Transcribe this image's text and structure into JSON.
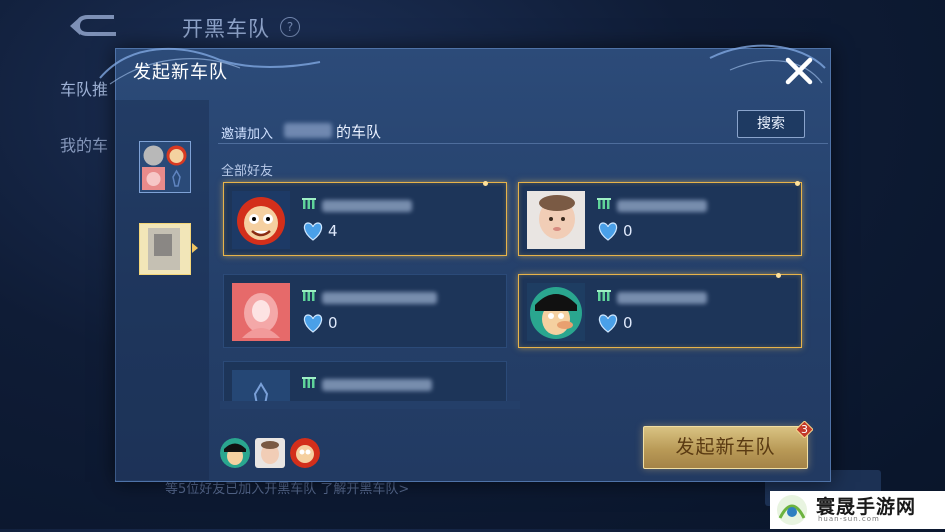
{
  "background": {
    "title": "开黑车队",
    "help": "?",
    "sidebar_item_1": "车队推",
    "sidebar_item_2": "我的车",
    "footer_hint": "等5位好友已加入开黑车队  了解开黑车队>"
  },
  "dialog": {
    "title": "发起新车队",
    "invite_prefix": "邀请加入",
    "invite_suffix": "的车队",
    "search_label": "搜索",
    "section_label": "全部好友",
    "start_button": "发起新车队",
    "start_badge": "3"
  },
  "friends": [
    {
      "hearts": "4",
      "selected": true,
      "avatar": "cartoon-red-face"
    },
    {
      "hearts": "0",
      "selected": true,
      "avatar": "baby-photo"
    },
    {
      "hearts": "0",
      "selected": false,
      "avatar": "pink-portrait"
    },
    {
      "hearts": "0",
      "selected": true,
      "avatar": "cartoon-green-face"
    },
    {
      "hearts": "",
      "selected": false,
      "avatar": "default-avatar"
    }
  ],
  "watermark": {
    "text": "寰晟手游网",
    "sub": "huan-sun.com"
  },
  "colors": {
    "accent_gold": "#e7b34a",
    "panel": "#243f69"
  }
}
